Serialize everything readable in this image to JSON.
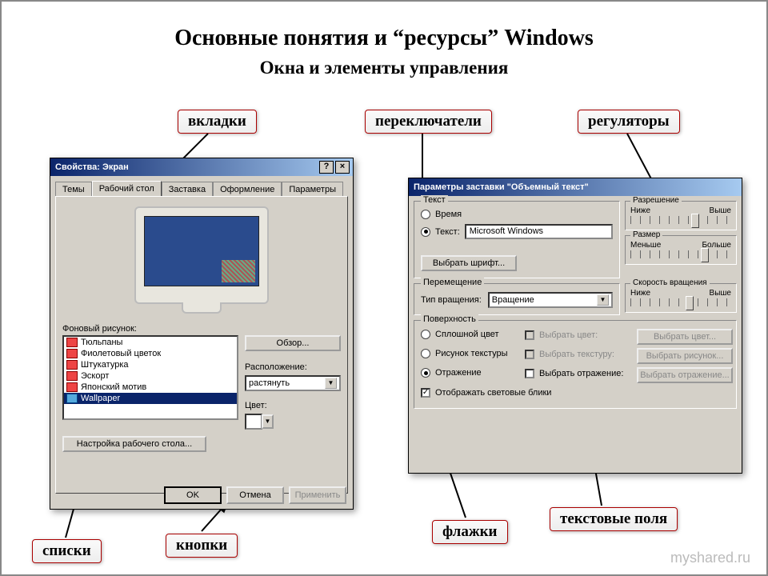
{
  "titles": {
    "main": "Основные понятия   и “ресурсы” Windows",
    "sub": "Окна и элементы управления"
  },
  "callouts": {
    "tabs": "вкладки",
    "radios": "переключатели",
    "sliders": "регуляторы",
    "lists": "списки",
    "buttons": "кнопки",
    "checkboxes": "флажки",
    "textfields": "текстовые поля"
  },
  "watermark": "myshared.ru",
  "dlg1": {
    "title": "Свойства: Экран",
    "help_btn": "?",
    "close_btn": "×",
    "tabs": [
      "Темы",
      "Рабочий стол",
      "Заставка",
      "Оформление",
      "Параметры"
    ],
    "active_tab": 1,
    "bg_label": "Фоновый рисунок:",
    "list": [
      "Тюльпаны",
      "Фиолетовый цветок",
      "Штукатурка",
      "Эскорт",
      "Японский мотив",
      "Wallpaper"
    ],
    "selected_index": 5,
    "browse_btn": "Обзор...",
    "placement_label": "Расположение:",
    "placement_value": "растянуть",
    "color_label": "Цвет:",
    "desktop_settings_btn": "Настройка рабочего стола...",
    "ok_btn": "OK",
    "cancel_btn": "Отмена",
    "apply_btn": "Применить"
  },
  "dlg2": {
    "title": "Параметры заставки \"Объемный текст\"",
    "grp_text": "Текст",
    "radio_time": "Время",
    "radio_text": "Текст:",
    "text_value": "Microsoft Windows",
    "font_btn": "Выбрать шрифт...",
    "grp_resolution": "Разрешение",
    "res_low": "Ниже",
    "res_high": "Выше",
    "grp_size": "Размер",
    "size_low": "Меньше",
    "size_high": "Больше",
    "grp_move": "Перемещение",
    "rotation_type_label": "Тип вращения:",
    "rotation_value": "Вращение",
    "grp_speed": "Скорость вращения",
    "spd_low": "Ниже",
    "spd_high": "Выше",
    "grp_surface": "Поверхность",
    "radio_solid": "Сплошной цвет",
    "chk_pickcolor": "Выбрать цвет:",
    "btn_pickcolor": "Выбрать цвет...",
    "radio_texture": "Рисунок текстуры",
    "chk_picktex": "Выбрать текстуру:",
    "btn_picktex": "Выбрать рисунок...",
    "radio_reflect": "Отражение",
    "chk_pickrefl": "Выбрать отражение:",
    "btn_pickrefl": "Выбрать отражение...",
    "chk_highlights": "Отображать световые блики"
  }
}
